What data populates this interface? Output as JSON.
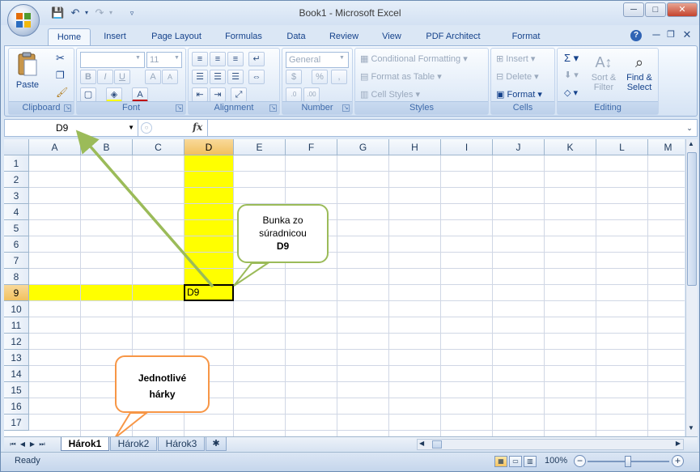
{
  "window": {
    "title": "Book1 - Microsoft Excel"
  },
  "quick_access": {
    "save_icon": "save-icon",
    "undo_icon": "undo-icon",
    "redo_icon": "redo-icon"
  },
  "ribbon_tabs": [
    "Home",
    "Insert",
    "Page Layout",
    "Formulas",
    "Data",
    "Review",
    "View",
    "PDF Architect",
    "Format"
  ],
  "ribbon": {
    "clipboard": {
      "label": "Clipboard",
      "paste": "Paste"
    },
    "font": {
      "label": "Font",
      "font_name": "",
      "font_size": "11"
    },
    "alignment": {
      "label": "Alignment"
    },
    "number": {
      "label": "Number",
      "format": "General"
    },
    "styles": {
      "label": "Styles",
      "conditional_formatting": "Conditional Formatting",
      "format_as_table": "Format as Table",
      "cell_styles": "Cell Styles"
    },
    "cells": {
      "label": "Cells",
      "insert": "Insert",
      "delete": "Delete",
      "format": "Format"
    },
    "editing": {
      "label": "Editing",
      "sort_filter_1": "Sort &",
      "sort_filter_2": "Filter",
      "find_select_1": "Find &",
      "find_select_2": "Select"
    }
  },
  "formula_bar": {
    "name_box": "D9",
    "fx": "fx",
    "value": ""
  },
  "grid": {
    "columns": [
      "A",
      "B",
      "C",
      "D",
      "E",
      "F",
      "G",
      "H",
      "I",
      "J",
      "K",
      "L",
      "M"
    ],
    "rows": [
      "1",
      "2",
      "3",
      "4",
      "5",
      "6",
      "7",
      "8",
      "9",
      "10",
      "11",
      "12",
      "13",
      "14",
      "15",
      "16",
      "17"
    ],
    "active_cell": "D9",
    "active_cell_value": "D9",
    "highlight_color": "#ffff00"
  },
  "callouts": {
    "cell_callout": {
      "line1": "Bunka zo",
      "line2": "súradnicou",
      "line3": "D9",
      "border_color": "#9bbb59"
    },
    "sheets_callout": {
      "line1": "Jednotlivé",
      "line2": "hárky",
      "border_color": "#f79646"
    }
  },
  "sheets": [
    "Hárok1",
    "Hárok2",
    "Hárok3"
  ],
  "active_sheet": "Hárok1",
  "status": {
    "ready": "Ready",
    "zoom": "100%"
  }
}
